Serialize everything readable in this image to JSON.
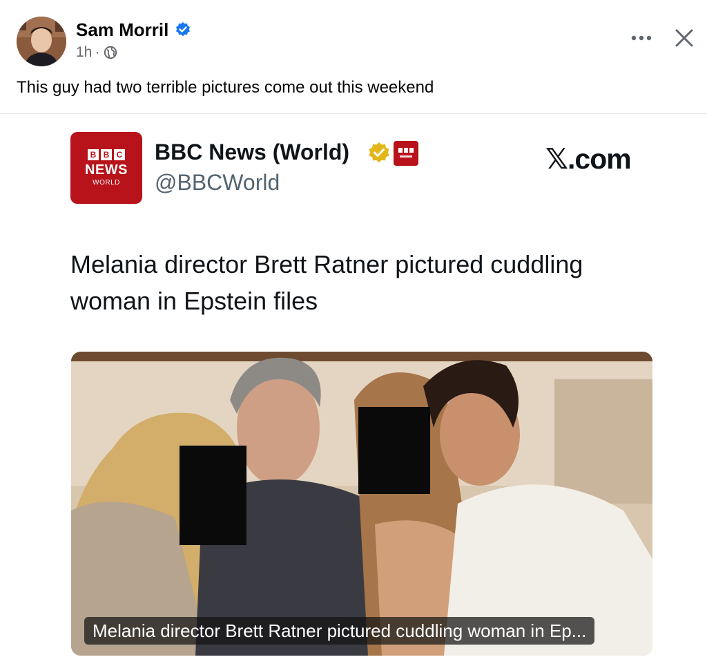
{
  "post": {
    "author": "Sam Morril",
    "time": "1h",
    "separator": "·",
    "text": "This guy had two terrible pictures come out this weekend"
  },
  "icons": {
    "avatar": "profile-photo",
    "verified": "verified-badge-icon",
    "privacy": "globe-icon",
    "more": "more-options-icon",
    "close": "close-icon"
  },
  "embed": {
    "logo_lines": [
      "B",
      "B",
      "C"
    ],
    "logo_news": "NEWS",
    "logo_world": "WORLD",
    "source_name": "BBC News (World)",
    "handle": "@BBCWorld",
    "platform": "𝕏.com",
    "headline": "Melania director Brett Ratner pictured cuddling woman in Epstein files",
    "caption": "Melania director Brett Ratner pictured cuddling woman in Ep..."
  },
  "colors": {
    "bbc_red": "#b8131b",
    "verified_blue": "#1877f2",
    "gold_badge": "#e2b719",
    "meta_gray": "#65676b",
    "handle_gray": "#536471"
  }
}
